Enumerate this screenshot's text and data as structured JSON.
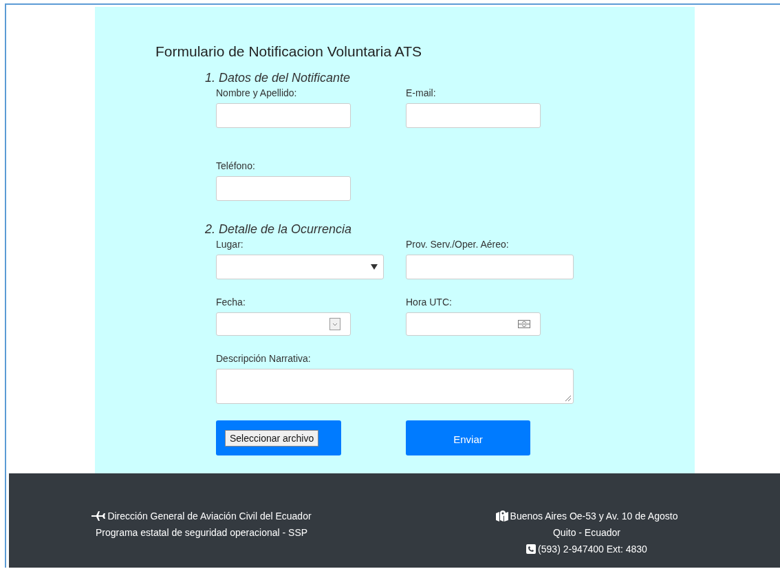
{
  "title": "Formulario de Notificacion Voluntaria ATS",
  "sections": [
    {
      "heading": "1. Datos de del Notificante",
      "fields": [
        {
          "label": "Nombre y Apellido:",
          "kind": "text"
        },
        {
          "label": "E-mail:",
          "kind": "text"
        },
        {
          "label": "Teléfono:",
          "kind": "text"
        }
      ]
    },
    {
      "heading": "2. Detalle de la Ocurrencia",
      "fields": [
        {
          "label": "Lugar:",
          "kind": "select"
        },
        {
          "label": "Prov. Serv./Oper. Aéreo:",
          "kind": "text"
        },
        {
          "label": "Fecha:",
          "kind": "date"
        },
        {
          "label": "Hora UTC:",
          "kind": "time"
        },
        {
          "label": "Descripción Narrativa:",
          "kind": "textarea"
        }
      ]
    }
  ],
  "file_button": "Seleccionar archivo",
  "submit_button": "Enviar",
  "footer": {
    "left": [
      {
        "text": "Dirección General de Aviación Civil del Ecuador",
        "kind": "plane"
      },
      {
        "text": "Programa estatal de seguridad operacional - SSP",
        "kind": "plain"
      }
    ],
    "right": [
      {
        "text": "Buenos Aires Oe-53 y Av. 10 de Agosto",
        "kind": "map"
      },
      {
        "text": "Quito - Ecuador",
        "kind": "plain"
      },
      {
        "text": "(593) 2-947400 Ext: 4830",
        "kind": "phone"
      }
    ]
  }
}
